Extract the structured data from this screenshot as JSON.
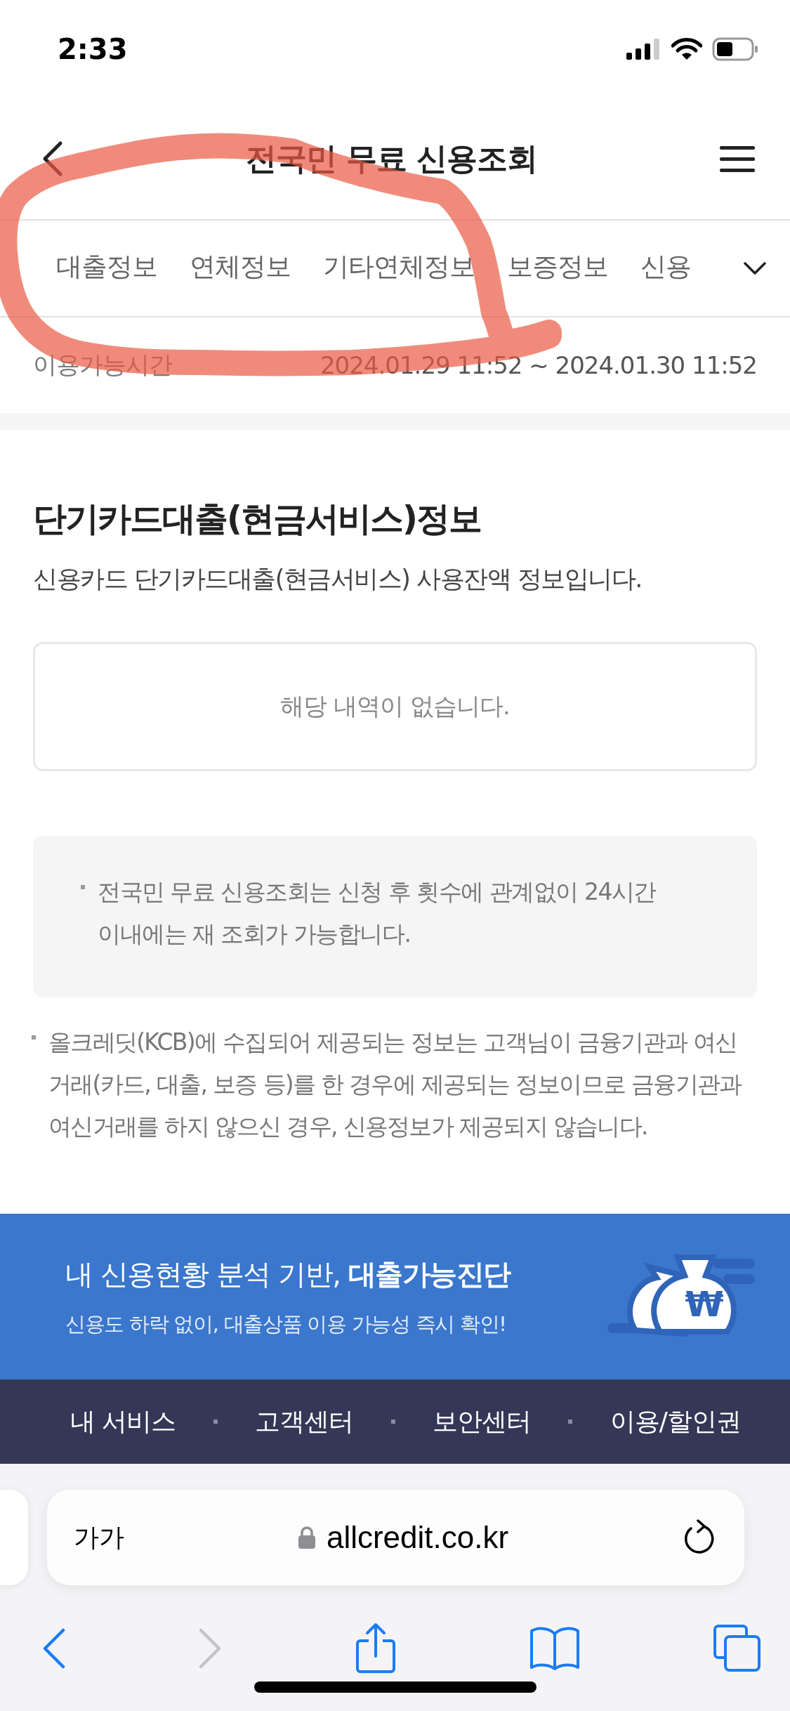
{
  "status_bar": {
    "time": "2:33"
  },
  "header": {
    "title": "전국민 무료 신용조회"
  },
  "tabs": [
    {
      "label": "대출정보",
      "selected": false
    },
    {
      "label": "연체정보",
      "selected": false
    },
    {
      "label": "기타연체정보",
      "selected": false
    },
    {
      "label": "보증정보",
      "selected": false
    },
    {
      "label": "신용",
      "selected": false
    }
  ],
  "availability": {
    "label": "이용가능시간",
    "value": "2024.01.29 11:52 ~ 2024.01.30 11:52"
  },
  "section": {
    "title": "단기카드대출(현금서비스)정보",
    "subtitle": "신용카드 단기카드대출(현금서비스) 사용잔액 정보입니다.",
    "empty_message": "해당 내역이 없습니다."
  },
  "notice": [
    "전국민 무료 신용조회는 신청 후 횟수에 관계없이 24시간 이내에는 재 조회가 가능합니다."
  ],
  "footnote": "올크레딧(KCB)에 수집되어 제공되는 정보는 고객님이 금융기관과 여신거래(카드, 대출, 보증 등)를 한 경우에 제공되는 정보이므로 금융기관과 여신거래를 하지 않으신 경우, 신용정보가 제공되지 않습니다.",
  "banner": {
    "title": "내 신용현황 분석 기반, **대출가능진단**",
    "subtitle": "신용도 하락 없이, 대출상품 이용 가능성 즉시 확인!",
    "symbol": "₩"
  },
  "footer_links": [
    "내 서비스",
    "고객센터",
    "보안센터",
    "이용/할인권"
  ],
  "browser": {
    "text_size": "가가",
    "url": "allcredit.co.kr",
    "forward_disabled": true
  }
}
